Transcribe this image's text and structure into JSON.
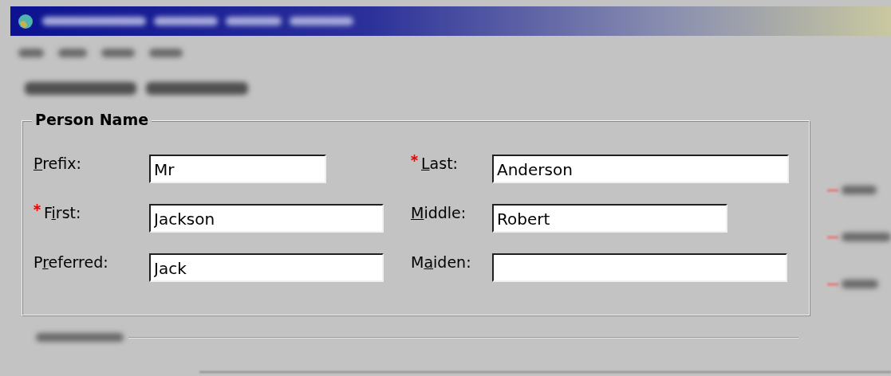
{
  "group": {
    "title": "Person Name"
  },
  "fields": [
    {
      "access_key": "P",
      "label_end": "refix:",
      "required": false,
      "value": "Mr"
    },
    {
      "access_key": "L",
      "label_end": "ast:",
      "required": true,
      "value": "Anderson"
    },
    {
      "label_start": "F",
      "access_key": "i",
      "label_end": "rst:",
      "required": true,
      "value": "Jackson"
    },
    {
      "access_key": "M",
      "label_end": "iddle:",
      "required": false,
      "value": "Robert"
    },
    {
      "label_start": "P",
      "access_key": "r",
      "label_end": "eferred:",
      "required": false,
      "value": "Jack"
    },
    {
      "label_start": "M",
      "access_key": "a",
      "label_end": "iden:",
      "required": false
    }
  ]
}
